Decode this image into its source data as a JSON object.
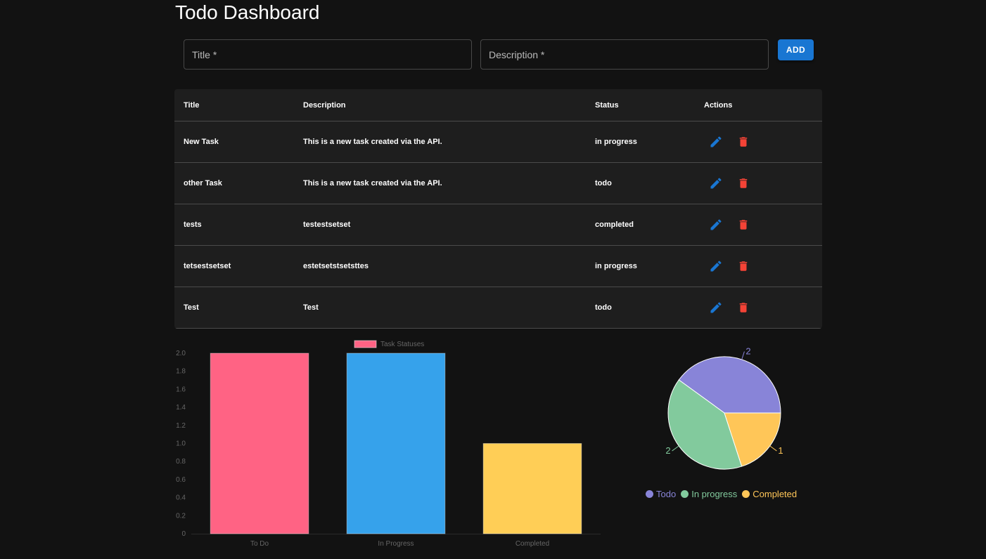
{
  "page": {
    "title": "Todo Dashboard"
  },
  "form": {
    "title_label": "Title *",
    "description_label": "Description *",
    "add_label": "ADD"
  },
  "table": {
    "headers": {
      "title": "Title",
      "description": "Description",
      "status": "Status",
      "actions": "Actions"
    },
    "rows": [
      {
        "title": "New Task",
        "description": "This is a new task created via the API.",
        "status": "in progress"
      },
      {
        "title": "other Task",
        "description": "This is a new task created via the API.",
        "status": "todo"
      },
      {
        "title": "tests",
        "description": "testestsetset",
        "status": "completed"
      },
      {
        "title": "tetsestsetset",
        "description": "estetsetstsetsttes",
        "status": "in progress"
      },
      {
        "title": "Test",
        "description": "Test",
        "status": "todo"
      }
    ],
    "icons": {
      "edit": "pencil-icon",
      "delete": "trash-icon"
    },
    "colors": {
      "edit": "#1976d2",
      "delete": "#f44336"
    }
  },
  "chart_data": [
    {
      "type": "bar",
      "categories": [
        "To Do",
        "In Progress",
        "Completed"
      ],
      "series": [
        {
          "name": "Task Statuses",
          "values": [
            2,
            2,
            1
          ]
        }
      ],
      "colors": [
        "#ff6384",
        "#36a2eb",
        "#ffce56"
      ],
      "ylim": [
        0,
        2.0
      ],
      "yticks": [
        "0",
        "0.2",
        "0.4",
        "0.6",
        "0.8",
        "1.0",
        "1.2",
        "1.4",
        "1.6",
        "1.8",
        "2.0"
      ],
      "legend": "top"
    },
    {
      "type": "pie",
      "labels": [
        "Todo",
        "In progress",
        "Completed"
      ],
      "values": [
        2,
        2,
        1
      ],
      "colors": [
        "#8884d8",
        "#82ca9d",
        "#ffc658"
      ],
      "legend": "bottom"
    }
  ]
}
